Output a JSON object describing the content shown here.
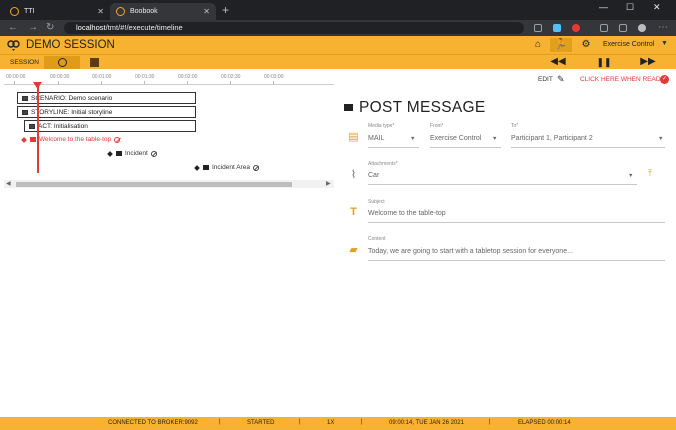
{
  "browser": {
    "tabs": [
      {
        "label": "TTI"
      },
      {
        "label": "Boobook"
      }
    ],
    "url_host": "localhost",
    "url_path": "/tmt/#!/execute/timeline"
  },
  "app": {
    "title": "DEMO SESSION",
    "role": "Exercise Control",
    "session_tab": "SESSION",
    "accent": "#f8b232"
  },
  "timeline": {
    "ticks": [
      "00:00:00",
      "00:00:30",
      "00:01:00",
      "00:01:30",
      "00:02:00",
      "00:02:30",
      "00:03:00"
    ],
    "scenario": "SCENARIO: Demo scenario",
    "storyline": "STORYLINE: Initial storyline",
    "act": "ACT: Initialisation",
    "events": [
      "Welcome to the table-top",
      "Incident",
      "Incident Area"
    ]
  },
  "panel": {
    "edit": "EDIT",
    "ready": "CLICK HERE WHEN READY",
    "title": "POST MESSAGE",
    "media_label": "Media type*",
    "media_value": "MAIL",
    "from_label": "From*",
    "from_value": "Exercise Control",
    "to_label": "To*",
    "to_value": "Participant 1, Participant 2",
    "attach_label": "Attachments*",
    "attach_value": "Car",
    "subject_label": "Subject",
    "subject_value": "Welcome to the table-top",
    "content_label": "Content",
    "content_value": "Today, we are going to start with a tabletop session for everyone..."
  },
  "status": {
    "broker": "CONNECTED TO BROKER:9092",
    "state": "STARTED",
    "speed": "1X",
    "time": "09:00:14, TUE JAN 26 2021",
    "elapsed": "ELAPSED 00:00:14"
  }
}
